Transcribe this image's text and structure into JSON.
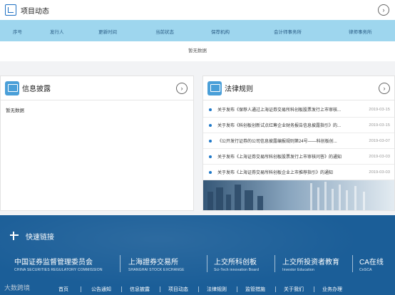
{
  "project": {
    "title": "项目动态",
    "columns": [
      "序号",
      "发行人",
      "更新时间",
      "当前状态",
      "保荐机构",
      "会计师事务所",
      "律师事务所"
    ],
    "empty_text": "暂无数据",
    "more_icon": "chevron-right-icon"
  },
  "info_disclosure": {
    "title": "信息披露",
    "empty_text": "暂无数据"
  },
  "law": {
    "title": "法律规则",
    "items": [
      {
        "title": "关于发布《保荐人通过上海证券交易所科创板股票发行上市审核...",
        "date": "2019-03-15"
      },
      {
        "title": "关于发布《科创板创新试点红筹企业财务报告信息披露指引》的...",
        "date": "2019-03-15"
      },
      {
        "title": "《公开发行证券的公司信息披露编报规则第24号——科创板创...",
        "date": "2019-03-07"
      },
      {
        "title": "关于发布《上海证券交易所科创板股票发行上市审核问答》的通知",
        "date": "2019-03-03"
      },
      {
        "title": "关于发布《上海证券交易所科创板企业上市推荐指引》的通知",
        "date": "2019-03-03"
      }
    ]
  },
  "footer": {
    "quick_links_title": "快速链接",
    "logos": [
      {
        "main": "中国证券监督管理委员会",
        "sub": "CHINA SECURITIES REGULATORY COMMISSION"
      },
      {
        "main": "上海證券交易所",
        "sub": "SHANGHAI STOCK EXCHANGE"
      },
      {
        "main": "上交所科创板",
        "sub": "Sci-Tech innovation Board"
      },
      {
        "main": "上交所投资者教育",
        "sub": "Investor   Education"
      },
      {
        "main": "CA在线",
        "sub": "CnSCA"
      }
    ],
    "nav": [
      "首页",
      "公告通知",
      "信息披露",
      "项目动态",
      "法律规则",
      "监管措施",
      "关于我们",
      "业务办理"
    ]
  },
  "watermark": "大数跨境"
}
